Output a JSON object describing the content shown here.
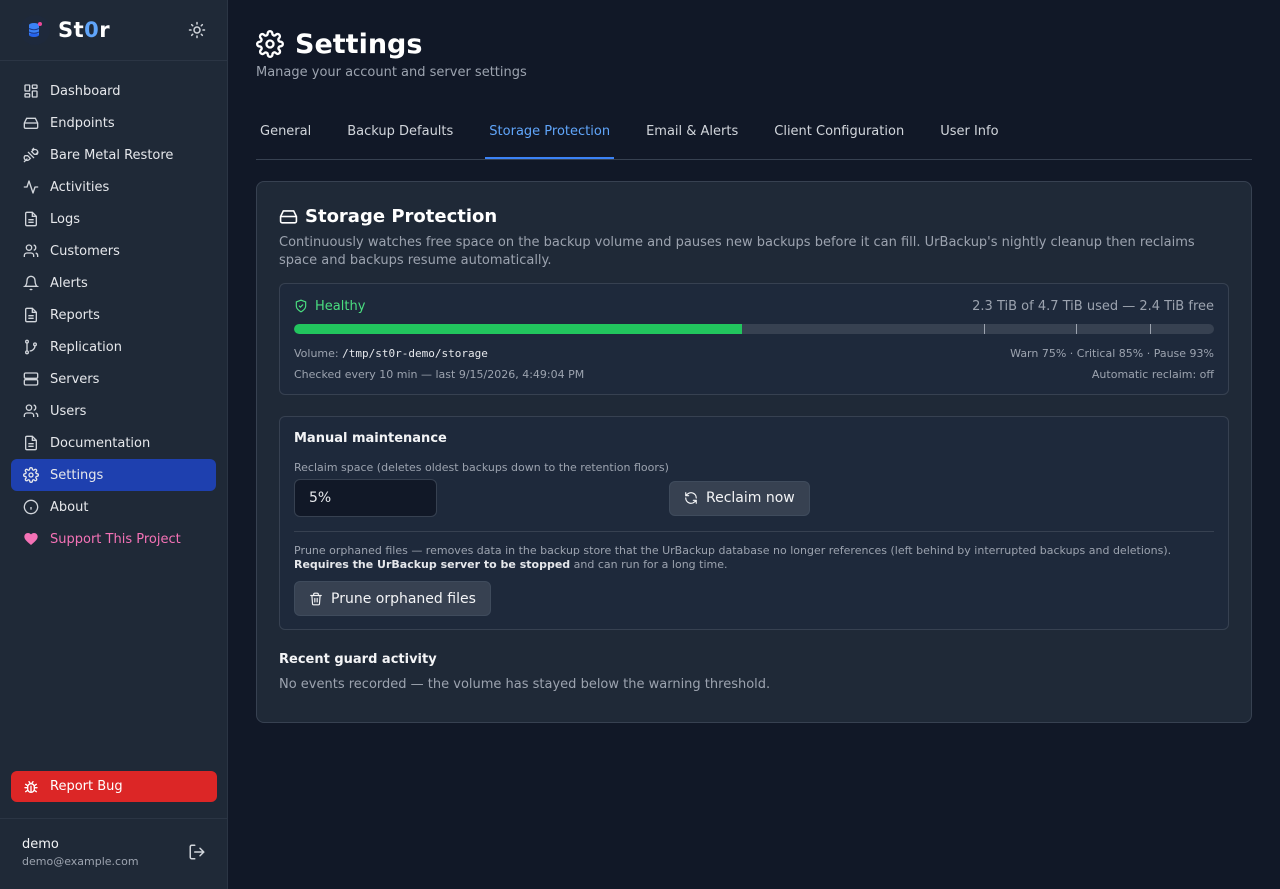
{
  "brand": {
    "name_prefix": "St",
    "name_zero": "0",
    "name_suffix": "r"
  },
  "sidebar": {
    "items": [
      {
        "label": "Dashboard",
        "icon": "grid-icon"
      },
      {
        "label": "Endpoints",
        "icon": "hard-drive-icon"
      },
      {
        "label": "Bare Metal Restore",
        "icon": "plug-icon"
      },
      {
        "label": "Activities",
        "icon": "activity-icon"
      },
      {
        "label": "Logs",
        "icon": "file-text-icon"
      },
      {
        "label": "Customers",
        "icon": "users-icon"
      },
      {
        "label": "Alerts",
        "icon": "bell-icon"
      },
      {
        "label": "Reports",
        "icon": "file-text-icon"
      },
      {
        "label": "Replication",
        "icon": "git-branch-icon"
      },
      {
        "label": "Servers",
        "icon": "server-icon"
      },
      {
        "label": "Users",
        "icon": "users-icon"
      },
      {
        "label": "Documentation",
        "icon": "file-text-icon"
      },
      {
        "label": "Settings",
        "icon": "gear-icon"
      },
      {
        "label": "About",
        "icon": "info-icon"
      },
      {
        "label": "Support This Project",
        "icon": "heart-icon"
      }
    ],
    "report_bug": "Report Bug",
    "user": {
      "name": "demo",
      "email": "demo@example.com"
    }
  },
  "page": {
    "title": "Settings",
    "subtitle": "Manage your account and server settings"
  },
  "tabs": [
    "General",
    "Backup Defaults",
    "Storage Protection",
    "Email & Alerts",
    "Client Configuration",
    "User Info"
  ],
  "card": {
    "title": "Storage Protection",
    "description": "Continuously watches free space on the backup volume and pauses new backups before it can fill. UrBackup's nightly cleanup then reclaims space and backups resume automatically.",
    "status": "Healthy",
    "usage": "2.3 TiB of 4.7 TiB used — 2.4 TiB free",
    "used_fraction": 0.487,
    "thresholds": [
      0.75,
      0.85,
      0.93
    ],
    "volume_label": "Volume: ",
    "volume_path": "/tmp/st0r-demo/storage",
    "threshold_text": "Warn 75% · Critical 85% · Pause 93%",
    "checked_text": "Checked every 10 min — last 9/15/2026, 4:49:04 PM",
    "auto_reclaim": "Automatic reclaim: off",
    "colors": {
      "healthy": "#4ade80",
      "bar_fill": "#22c55e",
      "accent": "#3b82f6",
      "danger": "#dc2626"
    }
  },
  "maintenance": {
    "title": "Manual maintenance",
    "reclaim_label": "Reclaim space (deletes oldest backups down to the retention floors)",
    "reclaim_value": "5%",
    "reclaim_button": "Reclaim now",
    "prune_desc_1": "Prune orphaned files — removes data in the backup store that the UrBackup database no longer references (left behind by interrupted backups and deletions). ",
    "prune_desc_bold": "Requires the UrBackup server to be stopped",
    "prune_desc_2": " and can run for a long time.",
    "prune_button": "Prune orphaned files"
  },
  "guard": {
    "title": "Recent guard activity",
    "text": "No events recorded — the volume has stayed below the warning threshold."
  }
}
